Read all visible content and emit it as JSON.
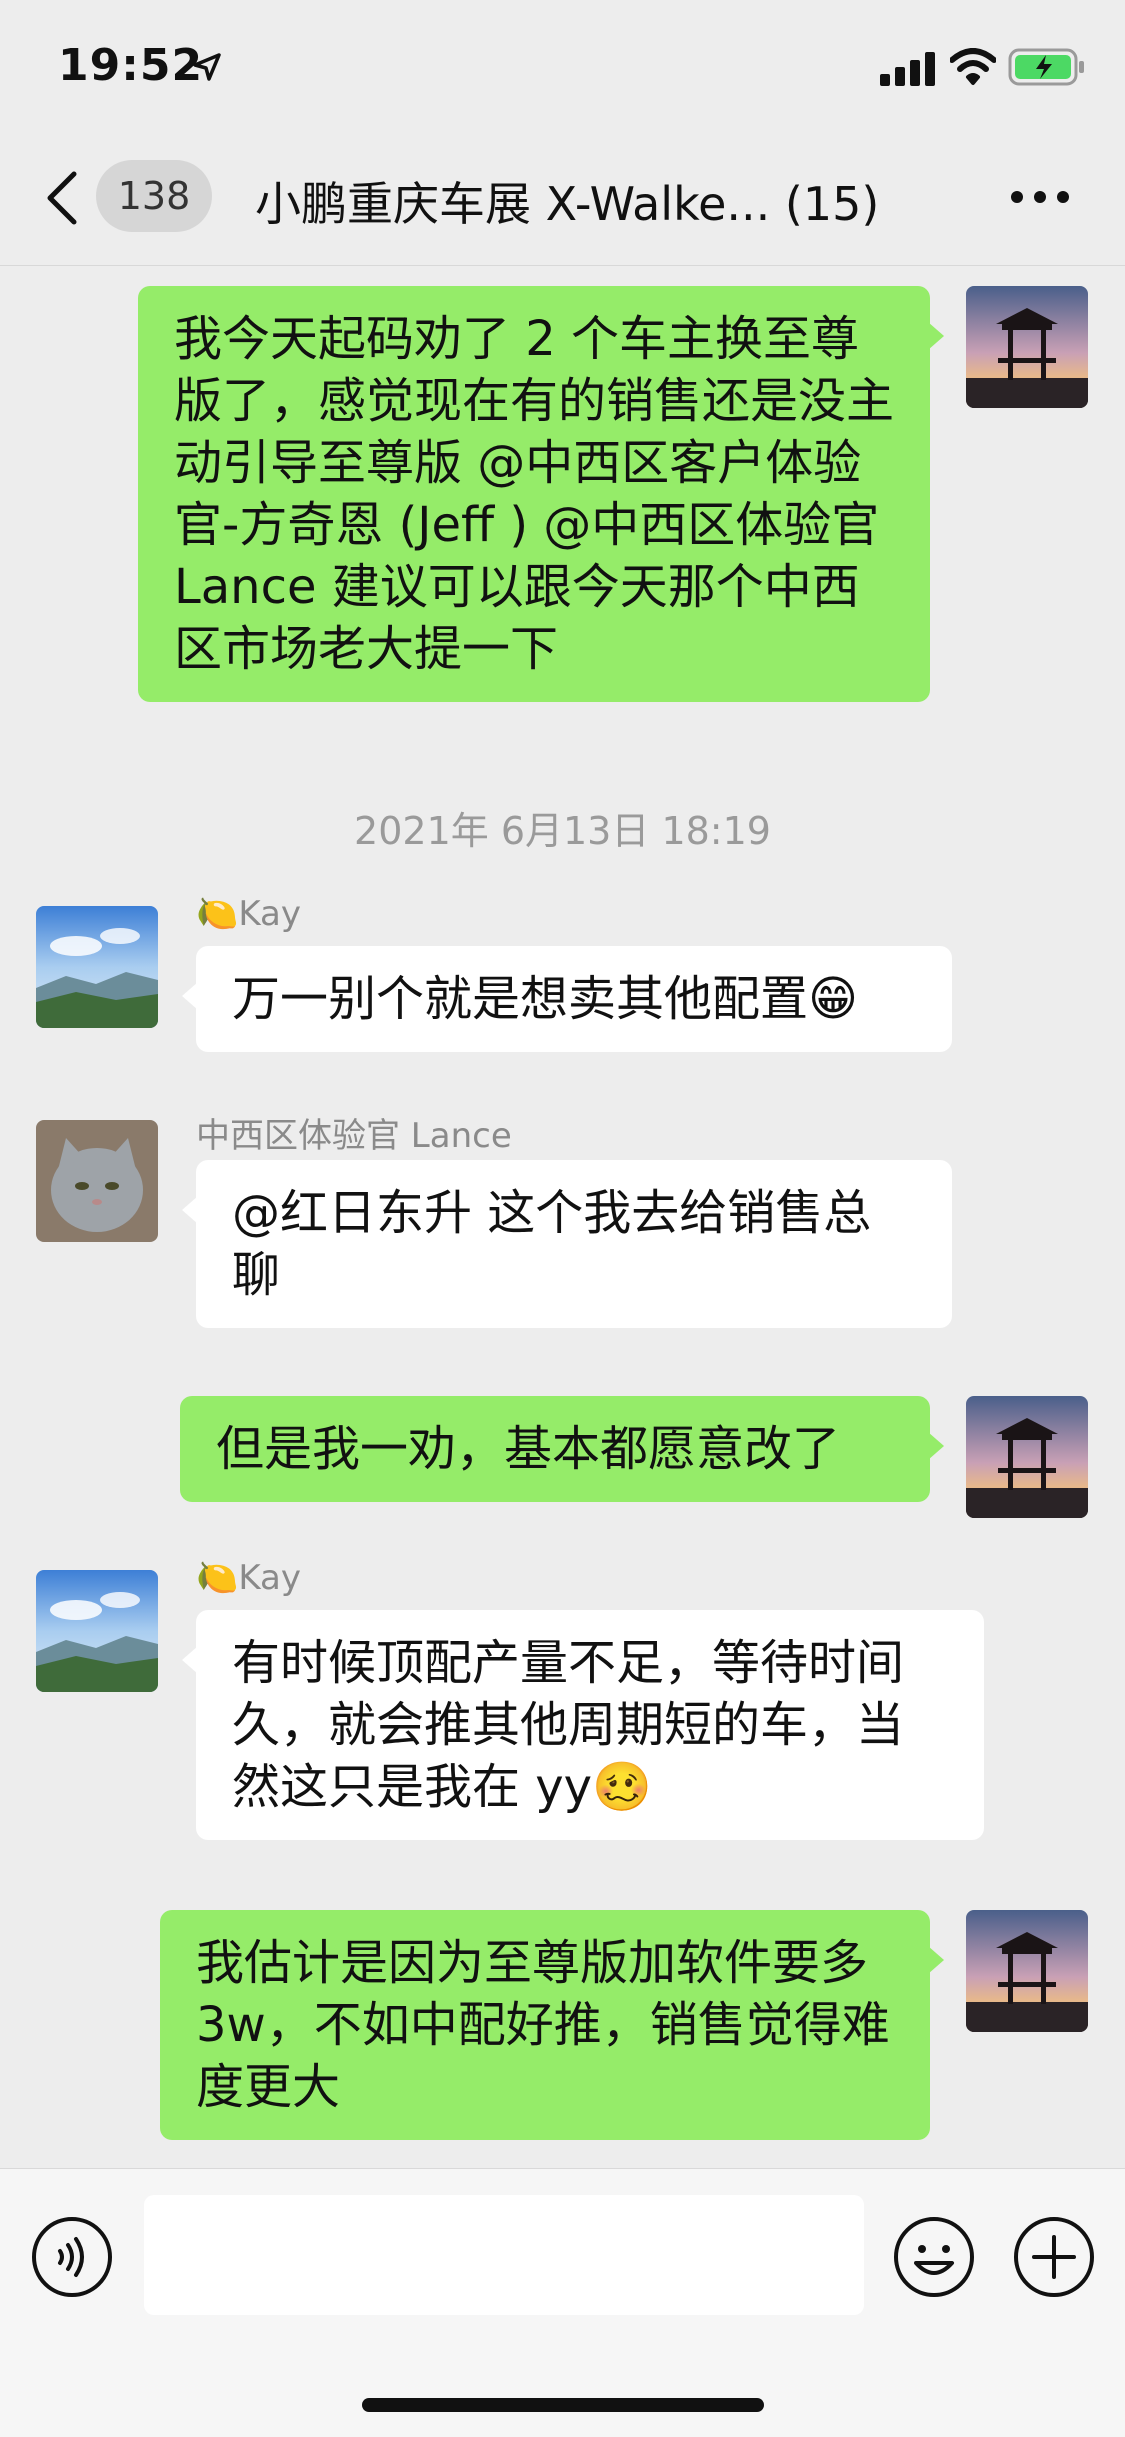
{
  "status_bar": {
    "time": "19:52"
  },
  "nav": {
    "back_count": "138",
    "title": "小鹏重庆车展 X-Walke... (15)"
  },
  "messages": [
    {
      "side": "me",
      "text": "我今天起码劝了 2 个车主换至尊版了，感觉现在有的销售还是没主动引导至尊版 @中西区客户体验官-方奇恩 (Jeff ) @中西区体验官 Lance 建议可以跟今天那个中西区市场老大提一下"
    },
    {
      "timestamp": "2021年 6月13日 18:19"
    },
    {
      "side": "other",
      "sender": "🍋Kay",
      "text": "万一别个就是想卖其他配置😁"
    },
    {
      "side": "other",
      "sender": "中西区体验官 Lance",
      "text": "@红日东升 这个我去给销售总聊"
    },
    {
      "side": "me",
      "text": "但是我一劝，基本都愿意改了"
    },
    {
      "side": "other",
      "sender": "🍋Kay",
      "text": "有时候顶配产量不足，等待时间久，就会推其他周期短的车，当然这只是我在 yy🥴"
    },
    {
      "side": "me",
      "text": "我估计是因为至尊版加软件要多 3w，不如中配好推，销售觉得难度更大"
    }
  ],
  "colors": {
    "my_bubble": "#95ec69",
    "other_bubble": "#ffffff",
    "background": "#ededed"
  },
  "input_bar": {
    "icons": [
      "voice-icon",
      "emoji-icon",
      "plus-icon"
    ]
  }
}
